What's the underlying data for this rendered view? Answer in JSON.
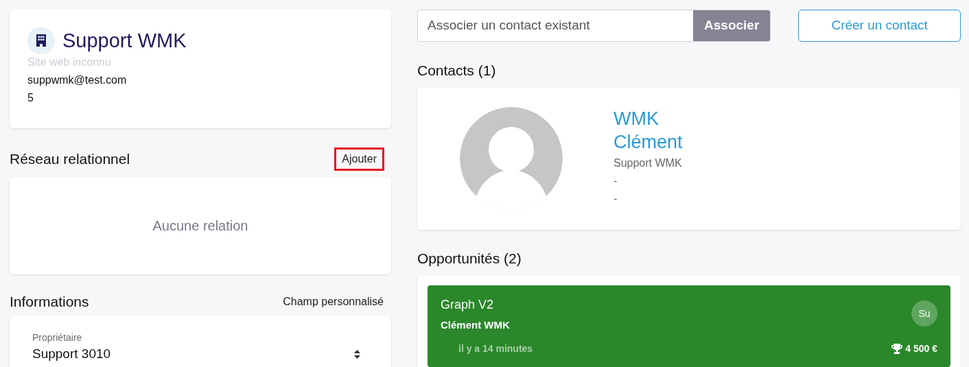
{
  "company": {
    "name": "Support WMK",
    "website": "Site web inconnu",
    "email": "suppwmk@test.com",
    "line_3": "5"
  },
  "network": {
    "title": "Réseau relationnel",
    "action": {
      "label": "Ajouter",
      "highlighted": true
    },
    "empty": "Aucune relation"
  },
  "informations": {
    "title": "Informations",
    "action": "Champ personnalisé",
    "fields": [
      {
        "label": "Propriétaire",
        "value": "Support 3010"
      }
    ]
  },
  "associate": {
    "placeholder": "Associer un contact existant",
    "button": "Associer"
  },
  "create_button": "Créer un contact",
  "contacts": {
    "title": "Contacts (1)",
    "items": [
      {
        "last_name": "WMK",
        "first_name": "Clément",
        "company": "Support WMK",
        "line_2": "-",
        "line_3": "-"
      }
    ]
  },
  "opportunities": {
    "title": "Opportunités (2)",
    "items": [
      {
        "title": "Graph V2",
        "contact": "Clément WMK",
        "time": "il y a 14 minutes",
        "amount": "4 500 €",
        "owner": "Su",
        "color": "#2a872a"
      }
    ]
  }
}
